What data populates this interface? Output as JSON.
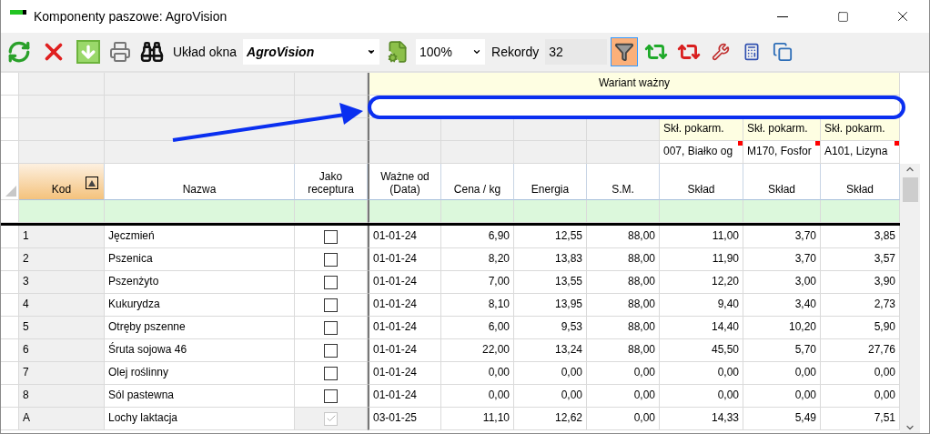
{
  "window": {
    "title": "Komponenty paszowe: AgroVision"
  },
  "toolbar": {
    "layout_label": "Układ okna",
    "layout_value": "AgroVision",
    "zoom_value": "100%",
    "records_label": "Rekordy",
    "records_value": "32",
    "filter_selected": true
  },
  "grid": {
    "band_title": "Wariant ważny",
    "nutrient_columns": [
      {
        "group": "Skł. pokarm.",
        "name": "007, Białko og",
        "flagged": true
      },
      {
        "group": "Skł. pokarm.",
        "name": "M170, Fosfor",
        "flagged": true
      },
      {
        "group": "Skł. pokarm.",
        "name": "A101, Lizyna",
        "flagged": true
      }
    ],
    "columns": [
      {
        "label": "Kod",
        "selected": true
      },
      {
        "label": "Nazwa",
        "selected": false
      },
      {
        "label": "Jako receptura",
        "selected": false
      },
      {
        "label": "Ważne od (Data)",
        "selected": false
      },
      {
        "label": "Cena / kg",
        "selected": false
      },
      {
        "label": "Energia",
        "selected": false
      },
      {
        "label": "S.M.",
        "selected": false
      },
      {
        "label": "Skład",
        "selected": false
      },
      {
        "label": "Skład",
        "selected": false
      },
      {
        "label": "Skład",
        "selected": false
      }
    ],
    "rows": [
      {
        "code": "1",
        "name": "Jęczmień",
        "recipe_checked": false,
        "recipe_disabled": false,
        "values": [
          "01-01-24",
          "6,90",
          "12,55",
          "88,00",
          "11,00",
          "3,70",
          "3,85"
        ]
      },
      {
        "code": "2",
        "name": "Pszenica",
        "recipe_checked": false,
        "recipe_disabled": false,
        "values": [
          "01-01-24",
          "8,20",
          "13,83",
          "88,00",
          "11,90",
          "3,70",
          "3,57"
        ]
      },
      {
        "code": "3",
        "name": "Pszenżyto",
        "recipe_checked": false,
        "recipe_disabled": false,
        "values": [
          "01-01-24",
          "7,00",
          "13,55",
          "88,00",
          "12,20",
          "3,00",
          "3,90"
        ]
      },
      {
        "code": "4",
        "name": "Kukurydza",
        "recipe_checked": false,
        "recipe_disabled": false,
        "values": [
          "01-01-24",
          "8,10",
          "13,95",
          "88,00",
          "9,40",
          "3,40",
          "2,73"
        ]
      },
      {
        "code": "5",
        "name": "Otręby pszenne",
        "recipe_checked": false,
        "recipe_disabled": false,
        "values": [
          "01-01-24",
          "6,00",
          "9,53",
          "88,00",
          "14,40",
          "10,20",
          "5,90"
        ]
      },
      {
        "code": "6",
        "name": "Śruta sojowa 46",
        "recipe_checked": false,
        "recipe_disabled": false,
        "values": [
          "01-01-24",
          "22,00",
          "13,24",
          "88,00",
          "45,50",
          "5,70",
          "27,76"
        ]
      },
      {
        "code": "7",
        "name": "Olej roślinny",
        "recipe_checked": false,
        "recipe_disabled": false,
        "values": [
          "01-01-24",
          "0,00",
          "0,00",
          "0,00",
          "0,00",
          "0,00",
          "0,00"
        ]
      },
      {
        "code": "8",
        "name": "Sól pastewna",
        "recipe_checked": false,
        "recipe_disabled": false,
        "values": [
          "01-01-24",
          "0,00",
          "0,00",
          "0,00",
          "0,00",
          "0,00",
          "0,00"
        ]
      },
      {
        "code": "A",
        "name": "Lochy laktacja",
        "recipe_checked": true,
        "recipe_disabled": true,
        "values": [
          "03-01-25",
          "11,10",
          "12,62",
          "0,00",
          "14,33",
          "5,49",
          "7,51"
        ]
      }
    ]
  }
}
